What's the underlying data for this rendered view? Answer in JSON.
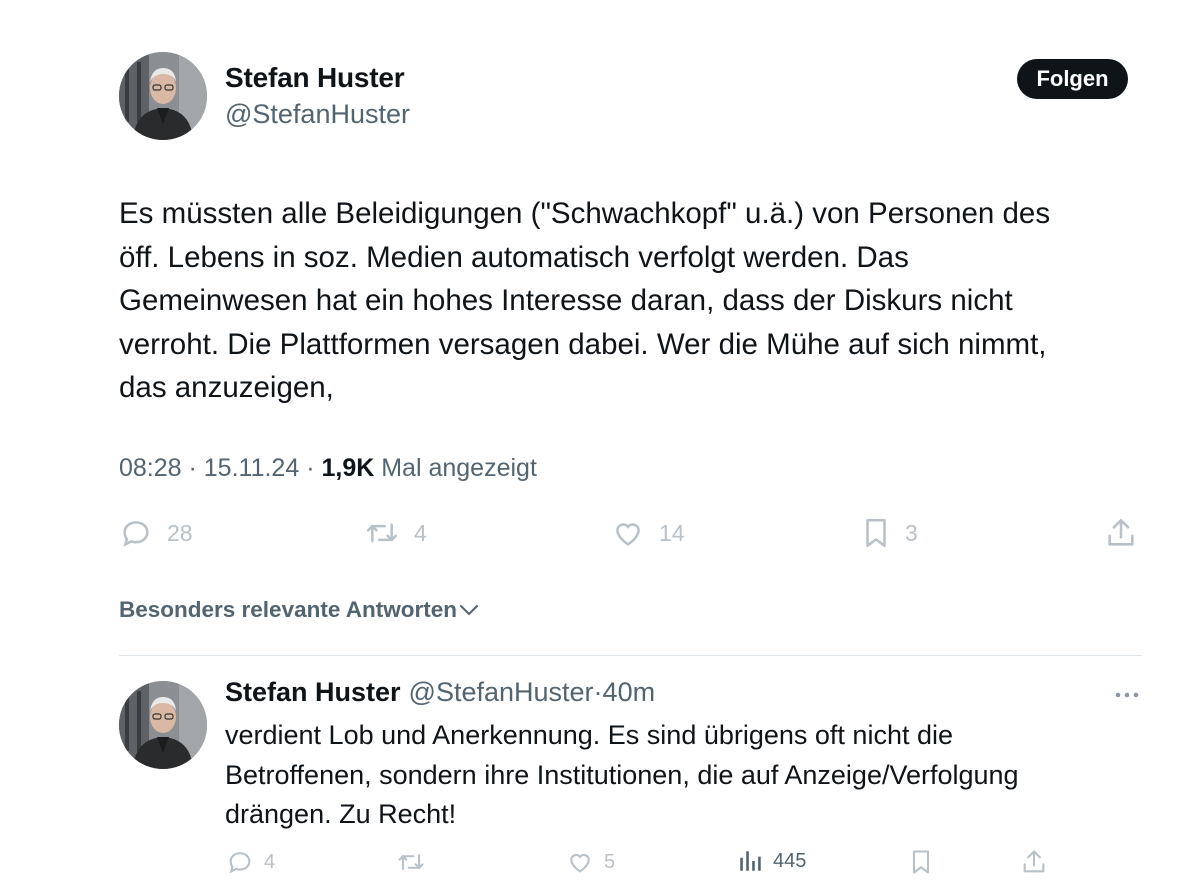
{
  "tweet": {
    "author": {
      "display_name": "Stefan Huster",
      "handle": "@StefanHuster"
    },
    "follow_label": "Folgen",
    "text_lines": [
      "Es müssten alle Beleidigungen (\"Schwachkopf\" u.ä.) von Personen des",
      "öff. Lebens in soz. Medien automatisch verfolgt werden. Das",
      "Gemeinwesen hat ein hohes Interesse daran, dass der Diskurs nicht",
      "verroht. Die Plattformen versagen dabei. Wer die Mühe auf sich nimmt,",
      "das anzuzeigen,"
    ],
    "meta": {
      "time": "08:28",
      "separator": " · ",
      "date": "15.11.24",
      "views": "1,9K",
      "views_label": "Mal angezeigt"
    },
    "actions": {
      "replies": "28",
      "reposts": "4",
      "likes": "14",
      "bookmarks": "3"
    }
  },
  "replies_sort": {
    "label": "Besonders relevante Antworten"
  },
  "reply": {
    "author": {
      "display_name": "Stefan Huster",
      "handle": "@StefanHuster"
    },
    "separator": "·",
    "time": "40m",
    "text_lines": [
      "verdient Lob und Anerkennung. Es sind übrigens oft nicht die",
      "Betroffenen, sondern ihre Institutionen, die auf Anzeige/Verfolgung",
      "drängen. Zu Recht!"
    ],
    "actions": {
      "replies": "4",
      "reposts": "",
      "likes": "5",
      "views": "445"
    }
  },
  "colors": {
    "text_primary": "#0f1419",
    "text_secondary": "#536471",
    "action_icon": "#b8c1c8",
    "follow_bg": "#0f1419",
    "divider": "#dfe4e8"
  },
  "icons": {
    "reply": "reply-icon",
    "repost": "repost-icon",
    "like": "like-icon",
    "bookmark": "bookmark-icon",
    "share": "share-icon",
    "views": "views-icon",
    "more": "more-icon",
    "chevron": "chevron-down-icon"
  }
}
